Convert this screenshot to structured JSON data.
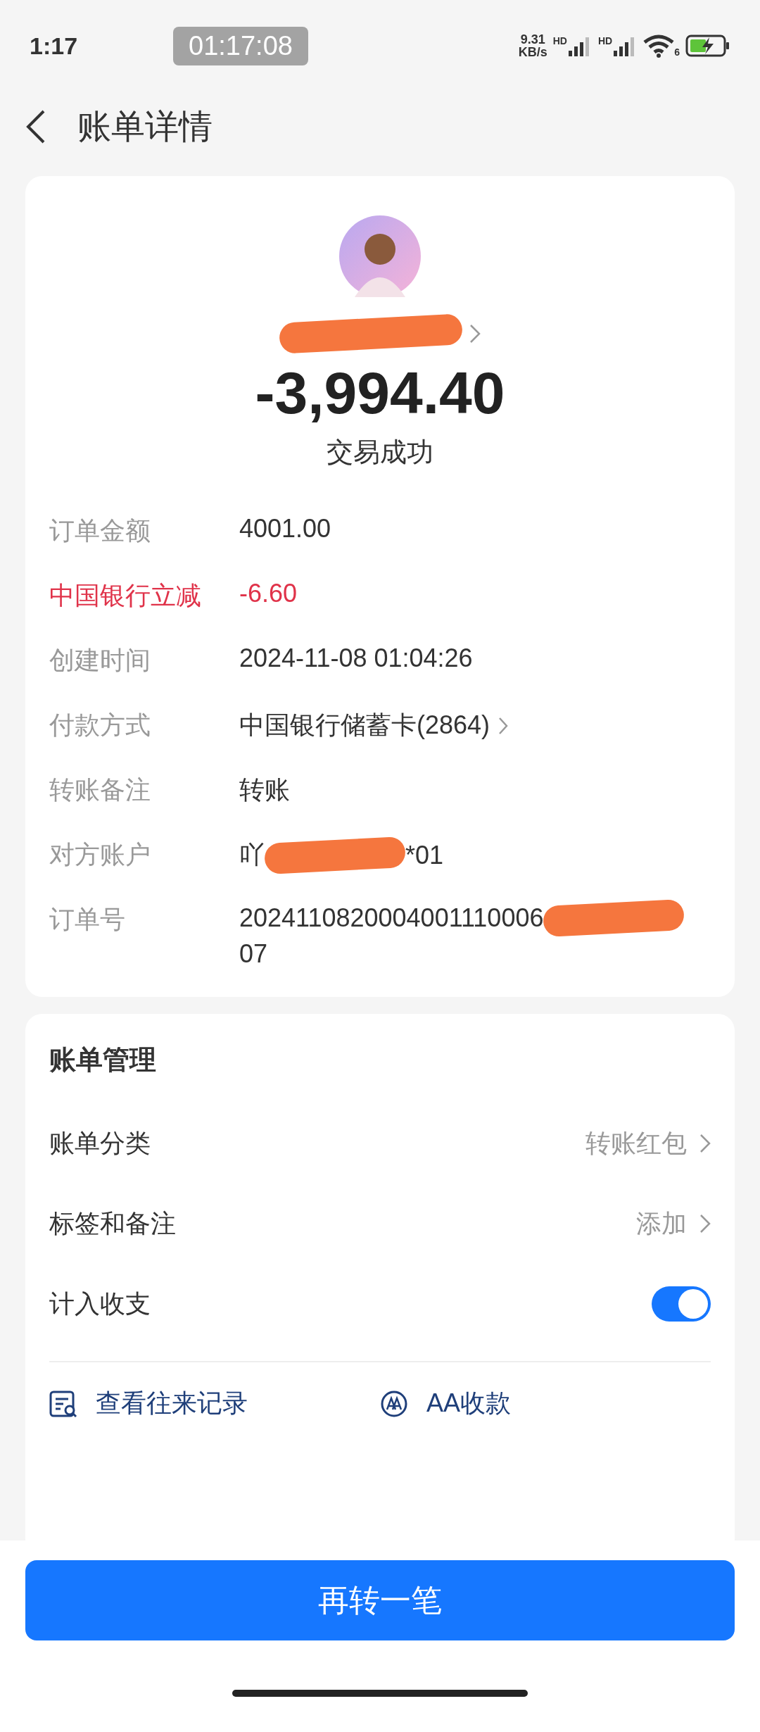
{
  "status_bar": {
    "time": "1:17",
    "clock_chip": "01:17:08",
    "speed_value": "9.31",
    "speed_unit": "KB/s",
    "signals": [
      {
        "label": "HD"
      },
      {
        "label": "HD"
      }
    ],
    "wifi_label": "6"
  },
  "header": {
    "title": "账单详情"
  },
  "summary": {
    "name": [
      {
        "kind": "redacted"
      }
    ],
    "amount": "-3,994.40",
    "status": "交易成功"
  },
  "details": [
    {
      "label": "订单金额",
      "highlight": false,
      "link": false,
      "value": [
        {
          "kind": "text",
          "text": "4001.00"
        }
      ]
    },
    {
      "label": "中国银行立减",
      "highlight": true,
      "link": false,
      "value": [
        {
          "kind": "text",
          "text": "-6.60"
        }
      ]
    },
    {
      "label": "创建时间",
      "highlight": false,
      "link": false,
      "value": [
        {
          "kind": "text",
          "text": "2024-11-08 01:04:26"
        }
      ]
    },
    {
      "label": "付款方式",
      "highlight": false,
      "link": true,
      "value": [
        {
          "kind": "text",
          "text": "中国银行储蓄卡(2864)"
        }
      ]
    },
    {
      "label": "转账备注",
      "highlight": false,
      "link": false,
      "value": [
        {
          "kind": "text",
          "text": "转账"
        }
      ]
    },
    {
      "label": "对方账户",
      "highlight": false,
      "link": false,
      "value": [
        {
          "kind": "text",
          "text": "吖"
        },
        {
          "kind": "redacted"
        },
        {
          "kind": "text",
          "text": "*01"
        }
      ]
    },
    {
      "label": "订单号",
      "highlight": false,
      "link": false,
      "value": [
        {
          "kind": "text",
          "text": "2024110820004001110006"
        },
        {
          "kind": "redacted"
        },
        {
          "kind": "break"
        },
        {
          "kind": "text",
          "text": "07"
        }
      ]
    }
  ],
  "management": {
    "title": "账单管理",
    "rows": [
      {
        "kind": "link",
        "label": "账单分类",
        "value": "转账红包"
      },
      {
        "kind": "link",
        "label": "标签和备注",
        "value": "添加"
      },
      {
        "kind": "switch",
        "label": "计入收支",
        "on": true
      }
    ],
    "actions": [
      {
        "kind": "records",
        "label": "查看往来记录"
      },
      {
        "kind": "split",
        "label": "AA收款"
      }
    ]
  },
  "primary_button": "再转一笔"
}
